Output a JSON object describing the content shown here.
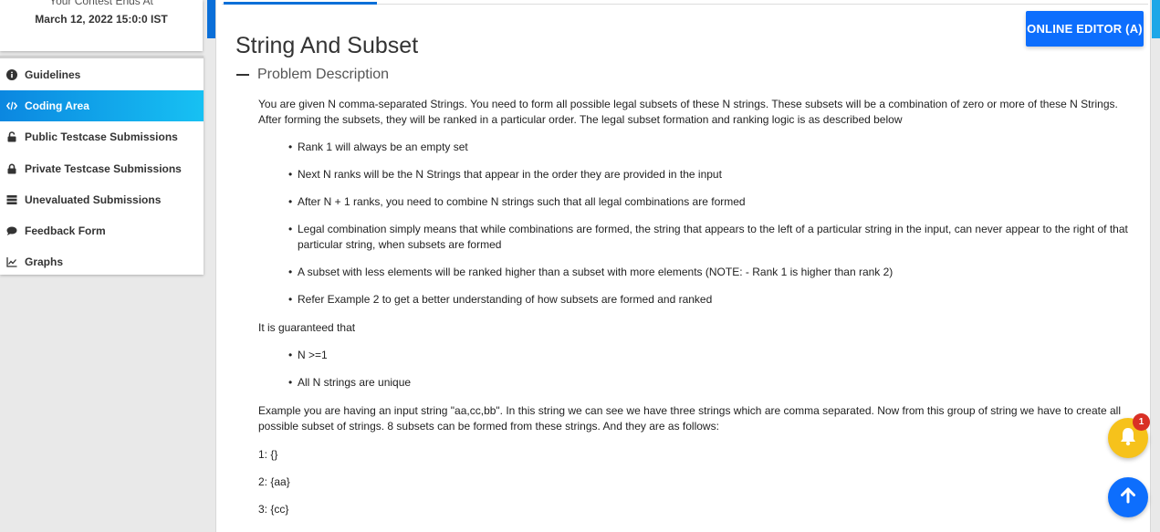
{
  "contest": {
    "label": "Your Contest Ends At",
    "end_date": "March 12, 2022 15:0:0 IST"
  },
  "sidebar": {
    "items": [
      {
        "label": "Guidelines",
        "icon": "info-icon",
        "active": false
      },
      {
        "label": "Coding Area",
        "icon": "code-icon",
        "active": true
      },
      {
        "label": "Public Testcase Submissions",
        "icon": "unlock-icon",
        "active": false
      },
      {
        "label": "Private Testcase Submissions",
        "icon": "lock-icon",
        "active": false
      },
      {
        "label": "Unevaluated Submissions",
        "icon": "list-icon",
        "active": false
      },
      {
        "label": "Feedback Form",
        "icon": "comment-icon",
        "active": false
      },
      {
        "label": "Graphs",
        "icon": "chart-line-icon",
        "active": false
      }
    ]
  },
  "header": {
    "editor_button": "ONLINE EDITOR (A)"
  },
  "problem": {
    "title": "String And Subset",
    "section_title": "Problem Description",
    "intro": "You are given N comma-separated Strings. You need to form all possible legal subsets of these N strings. These subsets will be a combination of zero or more of these N Strings. After forming the subsets, they will be ranked in a particular order. The legal subset formation and ranking logic is as described below",
    "rules": [
      "Rank 1 will always be an empty set",
      "Next N ranks will be the N Strings that appear in the order they are provided in the input",
      "After N + 1 ranks, you need to combine N strings such that all legal combinations are formed",
      "Legal combination simply means that while combinations are formed, the string that appears to the left of a particular string in the input, can never appear to the right of that particular string, when subsets are formed",
      "A subset with less elements will be ranked higher than a subset with more elements (NOTE: - Rank 1 is higher than rank 2)",
      "Refer Example 2 to get a better understanding of how subsets are formed and ranked"
    ],
    "guaranteed_label": "It is guaranteed that",
    "guarantees": [
      "N >=1",
      "All N strings are unique"
    ],
    "example_text": "Example you are having an input string \"aa,cc,bb\". In this string we can see we have three strings which are comma separated. Now from this group of string we have to create all possible subset of strings. 8 subsets can be formed from these strings. And they are as follows:",
    "example_lines": [
      "1: {}",
      "2: {aa}",
      "3: {cc}"
    ]
  },
  "notifications": {
    "count": "1"
  },
  "colors": {
    "accent": "#0d6efd",
    "active_gradient_start": "#0b87e0",
    "active_gradient_end": "#17c1f3",
    "bell": "#f6c21b",
    "badge": "#d93025"
  }
}
